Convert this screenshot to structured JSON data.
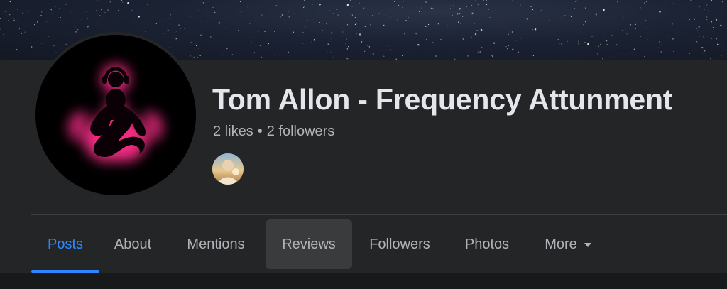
{
  "page": {
    "name": "Tom Allon - Frequency Attunment",
    "likes": "2 likes",
    "separator": "•",
    "followers": "2 followers"
  },
  "profile_picture": {
    "icon": "meditation-headphones-icon",
    "glow_color": "#ff2d8a"
  },
  "tabs": [
    {
      "label": "Posts",
      "active": true
    },
    {
      "label": "About"
    },
    {
      "label": "Mentions"
    },
    {
      "label": "Reviews",
      "hovered": true
    },
    {
      "label": "Followers"
    },
    {
      "label": "Photos"
    },
    {
      "label": "More",
      "icon": "caret-down-icon"
    }
  ],
  "colors": {
    "background": "#18191a",
    "panel": "#242526",
    "accent": "#2d88ff",
    "text_primary": "#e4e6eb",
    "text_secondary": "#b0b3b8"
  }
}
